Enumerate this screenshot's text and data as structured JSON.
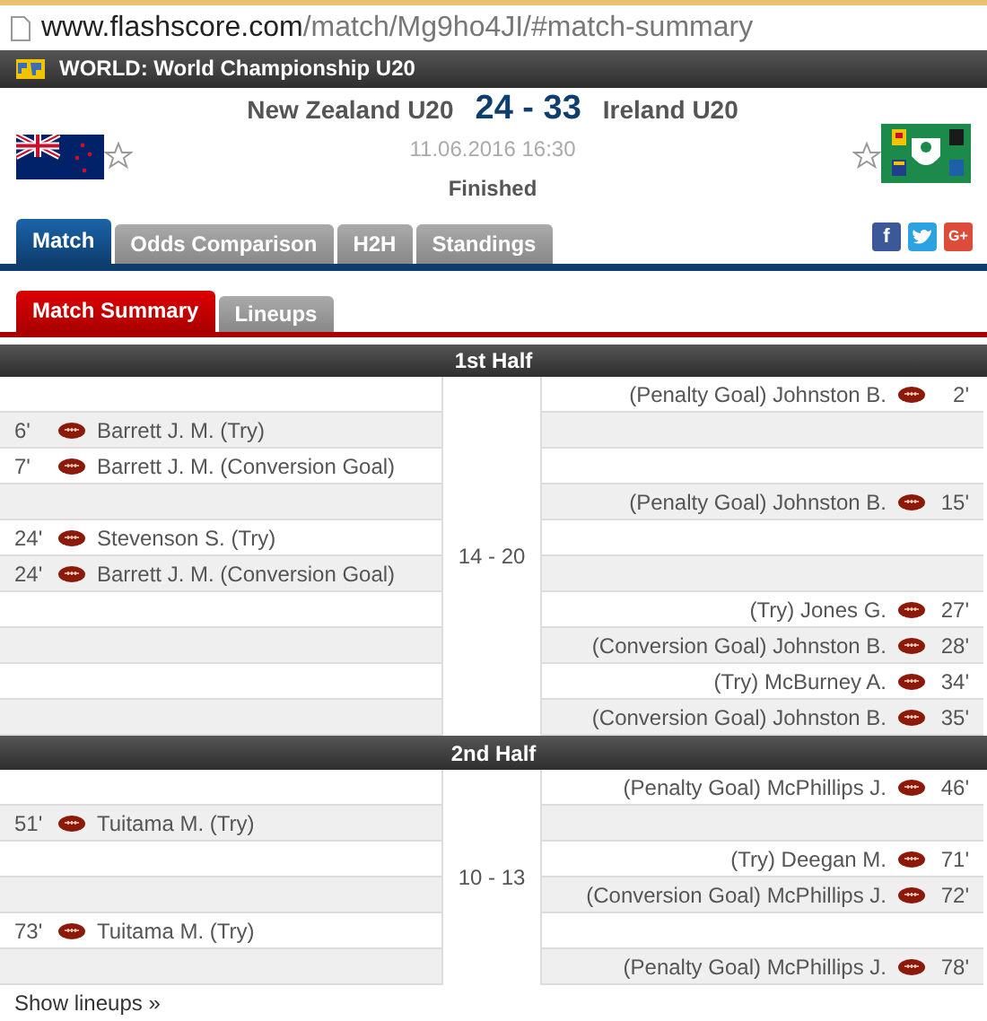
{
  "address_bar": {
    "domain": "www.flashscore.com",
    "path": "/match/Mg9ho4JI/#match-summary"
  },
  "league": {
    "title": "WORLD: World Championship U20"
  },
  "match": {
    "home": "New Zealand U20",
    "away": "Ireland U20",
    "score": "24 - 33",
    "date": "11.06.2016 16:30",
    "status": "Finished"
  },
  "tabs": [
    {
      "label": "Match",
      "selected": true
    },
    {
      "label": "Odds Comparison",
      "selected": false
    },
    {
      "label": "H2H",
      "selected": false
    },
    {
      "label": "Standings",
      "selected": false
    }
  ],
  "share": [
    {
      "kind": "facebook",
      "label": "f"
    },
    {
      "kind": "twitter"
    },
    {
      "kind": "google",
      "label": "G+"
    }
  ],
  "subtabs": [
    {
      "label": "Match Summary",
      "selected": true
    },
    {
      "label": "Lineups",
      "selected": false
    }
  ],
  "halves": [
    {
      "title": "1st Half",
      "score": "14 - 20",
      "rows": [
        {
          "kind": "away",
          "time": "2'",
          "text": "(Penalty Goal) Johnston B."
        },
        {
          "kind": "home",
          "time": "6'",
          "text": "Barrett J. M. (Try)"
        },
        {
          "kind": "home",
          "time": "7'",
          "text": "Barrett J. M. (Conversion Goal)"
        },
        {
          "kind": "away",
          "time": "15'",
          "text": "(Penalty Goal) Johnston B."
        },
        {
          "kind": "home",
          "time": "24'",
          "text": "Stevenson S. (Try)"
        },
        {
          "kind": "home",
          "time": "24'",
          "text": "Barrett J. M. (Conversion Goal)"
        },
        {
          "kind": "away",
          "time": "27'",
          "text": "(Try) Jones G."
        },
        {
          "kind": "away",
          "time": "28'",
          "text": "(Conversion Goal) Johnston B."
        },
        {
          "kind": "away",
          "time": "34'",
          "text": "(Try) McBurney A."
        },
        {
          "kind": "away",
          "time": "35'",
          "text": "(Conversion Goal) Johnston B."
        }
      ]
    },
    {
      "title": "2nd Half",
      "score": "10 - 13",
      "rows": [
        {
          "kind": "away",
          "time": "46'",
          "text": "(Penalty Goal) McPhillips J."
        },
        {
          "kind": "home",
          "time": "51'",
          "text": "Tuitama M. (Try)"
        },
        {
          "kind": "away",
          "time": "71'",
          "text": "(Try) Deegan M."
        },
        {
          "kind": "away",
          "time": "72'",
          "text": "(Conversion Goal) McPhillips J."
        },
        {
          "kind": "home",
          "time": "73'",
          "text": "Tuitama M. (Try)"
        },
        {
          "kind": "away",
          "time": "78'",
          "text": "(Penalty Goal) McPhillips J."
        }
      ]
    }
  ],
  "footer_link": "Show lineups »"
}
